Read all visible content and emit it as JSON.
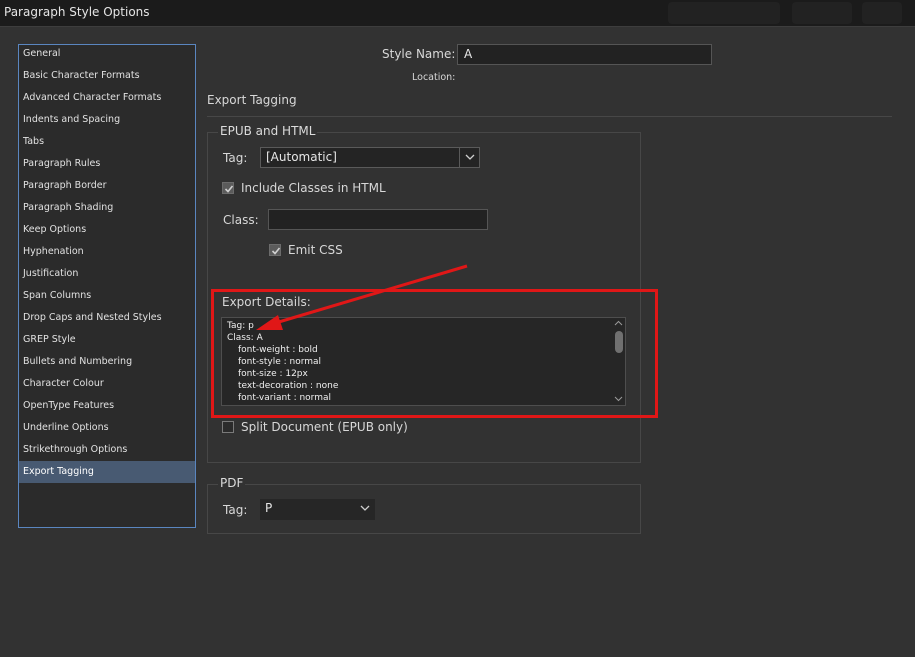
{
  "window": {
    "title": "Paragraph Style Options"
  },
  "sidebar": {
    "items": [
      {
        "label": "General"
      },
      {
        "label": "Basic Character Formats"
      },
      {
        "label": "Advanced Character Formats"
      },
      {
        "label": "Indents and Spacing"
      },
      {
        "label": "Tabs"
      },
      {
        "label": "Paragraph Rules"
      },
      {
        "label": "Paragraph Border"
      },
      {
        "label": "Paragraph Shading"
      },
      {
        "label": "Keep Options"
      },
      {
        "label": "Hyphenation"
      },
      {
        "label": "Justification"
      },
      {
        "label": "Span Columns"
      },
      {
        "label": "Drop Caps and Nested Styles"
      },
      {
        "label": "GREP Style"
      },
      {
        "label": "Bullets and Numbering"
      },
      {
        "label": "Character Colour"
      },
      {
        "label": "OpenType Features"
      },
      {
        "label": "Underline Options"
      },
      {
        "label": "Strikethrough Options"
      },
      {
        "label": "Export Tagging"
      }
    ],
    "selected": "Export Tagging"
  },
  "header": {
    "style_name_label": "Style Name:",
    "style_name_value": "A",
    "location_label": "Location:"
  },
  "section": {
    "title": "Export Tagging"
  },
  "epub": {
    "group_title": "EPUB and HTML",
    "tag_label": "Tag:",
    "tag_value": "[Automatic]",
    "include_classes_label": "Include Classes in HTML",
    "include_classes_checked": true,
    "class_label": "Class:",
    "class_value": "",
    "emit_css_label": "Emit CSS",
    "emit_css_checked": true,
    "export_details_label": "Export Details:",
    "export_details_lines": [
      "Tag: p",
      "Class: A",
      "font-weight : bold",
      "font-style : normal",
      "font-size : 12px",
      "text-decoration : none",
      "font-variant : normal"
    ],
    "split_document_label": "Split Document (EPUB only)",
    "split_document_checked": false
  },
  "pdf": {
    "group_title": "PDF",
    "tag_label": "Tag:",
    "tag_value": "P"
  },
  "annotation": {
    "color": "#e01717"
  }
}
